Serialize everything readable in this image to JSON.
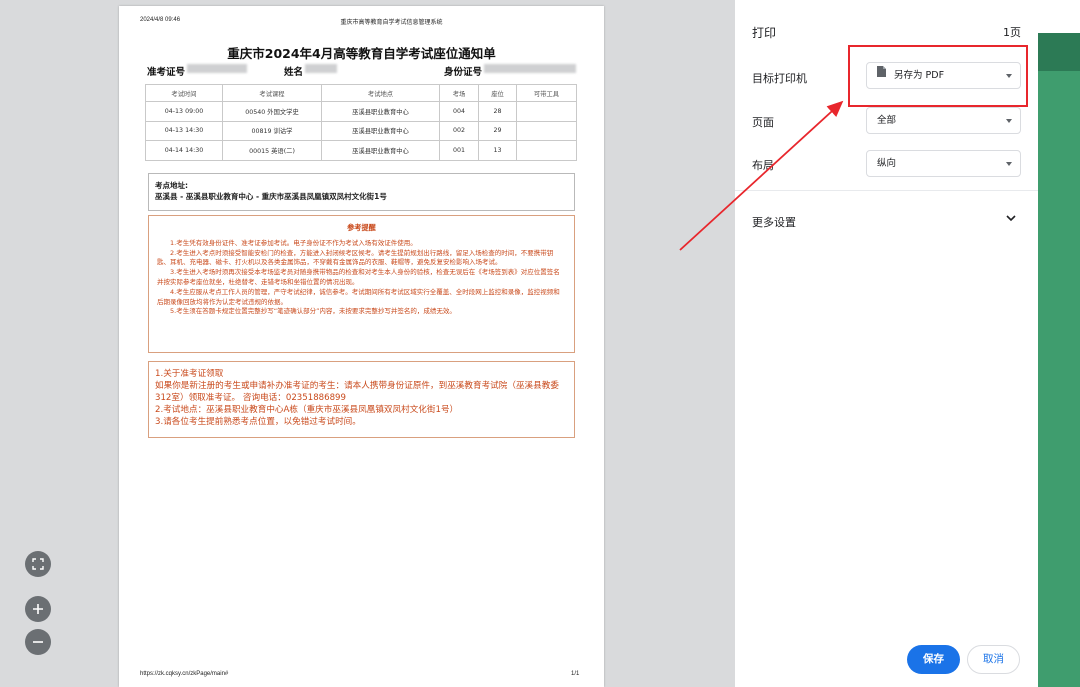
{
  "document": {
    "header_datetime": "2024/4/8 09:46",
    "header_system": "重庆市高等教育自学考试信息管理系统",
    "title": "重庆市2024年4月高等教育自学考试座位通知单",
    "admission_label": "准考证号",
    "name_label": "姓名",
    "id_label": "身份证号",
    "table": {
      "headers": [
        "考试时间",
        "考试课程",
        "考试地点",
        "考场",
        "座位",
        "可带工具"
      ],
      "rows": [
        [
          "04-13 09:00",
          "00540 外国文学史",
          "巫溪县职业教育中心",
          "004",
          "28",
          ""
        ],
        [
          "04-13 14:30",
          "00819 训诂学",
          "巫溪县职业教育中心",
          "002",
          "29",
          ""
        ],
        [
          "04-14 14:30",
          "00015 英语(二)",
          "巫溪县职业教育中心",
          "001",
          "13",
          ""
        ]
      ]
    },
    "address_label": "考点地址:",
    "address": "巫溪县 - 巫溪县职业教育中心 - 重庆市巫溪县凤凰镇双凤村文化街1号",
    "notice_title": "参考提醒",
    "notices": [
      "1.考生凭有效身份证件、准考证参加考试。电子身份证不作为考试入场有效证件使用。",
      "2.考生进入考点时须接受智能安检门的检查，方能进入封闭候考区候考。请考生提前规划出行路线，留足入场检查的时间，不要携带钥匙、耳机、充电器、磁卡、打火机以及各类金属饰品，不穿戴有金属饰品的衣服、鞋帽等，避免反复安检影响入场考试。",
      "3.考生进入考场时须再次接受本考场监考员对随身携带物品的检查和对考生本人身份的验核，检查无误后在《考场签到表》对应位置签名并按实际参考座位就坐，杜绝替考、走错考场和坐错位置的情况出现。",
      "4.考生应服从考点工作人员的管理，严守考试纪律，诚信参考。考试期间所有考试区域实行全覆盖、全时段网上监控和录像，监控视频和后期录像回放均将作为认定考试违规的依据。",
      "5.考生须在答题卡规定位置完整抄写“笔迹确认部分”内容，未按要求完整抄写并签名的，成绩无效。"
    ],
    "extra_lines": [
      "1.关于准考证领取",
      "如果你是新注册的考生或申请补办准考证的考生：请本人携带身份证原件，到巫溪教育考试院（巫溪县教委312室）领取准考证。 咨询电话：02351886899",
      "2.考试地点：巫溪县职业教育中心A栋（重庆市巫溪县凤凰镇双凤村文化街1号）",
      "3.请各位考生提前熟悉考点位置，以免错过考试时间。"
    ],
    "footer_url": "https://zk.cqksy.cn/zkPage/main#",
    "footer_page": "1/1"
  },
  "panel": {
    "title": "打印",
    "page_count": "1页",
    "printer_label": "目标打印机",
    "printer_value": "另存为 PDF",
    "pages_label": "页面",
    "pages_value": "全部",
    "layout_label": "布局",
    "layout_value": "纵向",
    "more_settings": "更多设置",
    "save_label": "保存",
    "cancel_label": "取消"
  },
  "colors": {
    "accent": "#1a73e8",
    "highlight": "#e8262c",
    "notice_text": "#c94a1c"
  }
}
